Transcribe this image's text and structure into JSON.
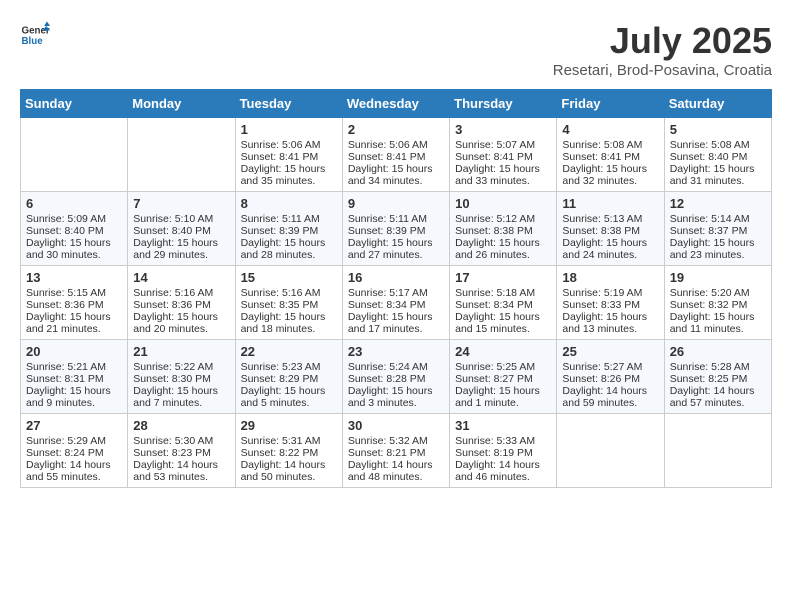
{
  "header": {
    "logo_line1": "General",
    "logo_line2": "Blue",
    "month_year": "July 2025",
    "location": "Resetari, Brod-Posavina, Croatia"
  },
  "weekdays": [
    "Sunday",
    "Monday",
    "Tuesday",
    "Wednesday",
    "Thursday",
    "Friday",
    "Saturday"
  ],
  "weeks": [
    [
      {
        "day": "",
        "sunrise": "",
        "sunset": "",
        "daylight": ""
      },
      {
        "day": "",
        "sunrise": "",
        "sunset": "",
        "daylight": ""
      },
      {
        "day": "1",
        "sunrise": "Sunrise: 5:06 AM",
        "sunset": "Sunset: 8:41 PM",
        "daylight": "Daylight: 15 hours and 35 minutes."
      },
      {
        "day": "2",
        "sunrise": "Sunrise: 5:06 AM",
        "sunset": "Sunset: 8:41 PM",
        "daylight": "Daylight: 15 hours and 34 minutes."
      },
      {
        "day": "3",
        "sunrise": "Sunrise: 5:07 AM",
        "sunset": "Sunset: 8:41 PM",
        "daylight": "Daylight: 15 hours and 33 minutes."
      },
      {
        "day": "4",
        "sunrise": "Sunrise: 5:08 AM",
        "sunset": "Sunset: 8:41 PM",
        "daylight": "Daylight: 15 hours and 32 minutes."
      },
      {
        "day": "5",
        "sunrise": "Sunrise: 5:08 AM",
        "sunset": "Sunset: 8:40 PM",
        "daylight": "Daylight: 15 hours and 31 minutes."
      }
    ],
    [
      {
        "day": "6",
        "sunrise": "Sunrise: 5:09 AM",
        "sunset": "Sunset: 8:40 PM",
        "daylight": "Daylight: 15 hours and 30 minutes."
      },
      {
        "day": "7",
        "sunrise": "Sunrise: 5:10 AM",
        "sunset": "Sunset: 8:40 PM",
        "daylight": "Daylight: 15 hours and 29 minutes."
      },
      {
        "day": "8",
        "sunrise": "Sunrise: 5:11 AM",
        "sunset": "Sunset: 8:39 PM",
        "daylight": "Daylight: 15 hours and 28 minutes."
      },
      {
        "day": "9",
        "sunrise": "Sunrise: 5:11 AM",
        "sunset": "Sunset: 8:39 PM",
        "daylight": "Daylight: 15 hours and 27 minutes."
      },
      {
        "day": "10",
        "sunrise": "Sunrise: 5:12 AM",
        "sunset": "Sunset: 8:38 PM",
        "daylight": "Daylight: 15 hours and 26 minutes."
      },
      {
        "day": "11",
        "sunrise": "Sunrise: 5:13 AM",
        "sunset": "Sunset: 8:38 PM",
        "daylight": "Daylight: 15 hours and 24 minutes."
      },
      {
        "day": "12",
        "sunrise": "Sunrise: 5:14 AM",
        "sunset": "Sunset: 8:37 PM",
        "daylight": "Daylight: 15 hours and 23 minutes."
      }
    ],
    [
      {
        "day": "13",
        "sunrise": "Sunrise: 5:15 AM",
        "sunset": "Sunset: 8:36 PM",
        "daylight": "Daylight: 15 hours and 21 minutes."
      },
      {
        "day": "14",
        "sunrise": "Sunrise: 5:16 AM",
        "sunset": "Sunset: 8:36 PM",
        "daylight": "Daylight: 15 hours and 20 minutes."
      },
      {
        "day": "15",
        "sunrise": "Sunrise: 5:16 AM",
        "sunset": "Sunset: 8:35 PM",
        "daylight": "Daylight: 15 hours and 18 minutes."
      },
      {
        "day": "16",
        "sunrise": "Sunrise: 5:17 AM",
        "sunset": "Sunset: 8:34 PM",
        "daylight": "Daylight: 15 hours and 17 minutes."
      },
      {
        "day": "17",
        "sunrise": "Sunrise: 5:18 AM",
        "sunset": "Sunset: 8:34 PM",
        "daylight": "Daylight: 15 hours and 15 minutes."
      },
      {
        "day": "18",
        "sunrise": "Sunrise: 5:19 AM",
        "sunset": "Sunset: 8:33 PM",
        "daylight": "Daylight: 15 hours and 13 minutes."
      },
      {
        "day": "19",
        "sunrise": "Sunrise: 5:20 AM",
        "sunset": "Sunset: 8:32 PM",
        "daylight": "Daylight: 15 hours and 11 minutes."
      }
    ],
    [
      {
        "day": "20",
        "sunrise": "Sunrise: 5:21 AM",
        "sunset": "Sunset: 8:31 PM",
        "daylight": "Daylight: 15 hours and 9 minutes."
      },
      {
        "day": "21",
        "sunrise": "Sunrise: 5:22 AM",
        "sunset": "Sunset: 8:30 PM",
        "daylight": "Daylight: 15 hours and 7 minutes."
      },
      {
        "day": "22",
        "sunrise": "Sunrise: 5:23 AM",
        "sunset": "Sunset: 8:29 PM",
        "daylight": "Daylight: 15 hours and 5 minutes."
      },
      {
        "day": "23",
        "sunrise": "Sunrise: 5:24 AM",
        "sunset": "Sunset: 8:28 PM",
        "daylight": "Daylight: 15 hours and 3 minutes."
      },
      {
        "day": "24",
        "sunrise": "Sunrise: 5:25 AM",
        "sunset": "Sunset: 8:27 PM",
        "daylight": "Daylight: 15 hours and 1 minute."
      },
      {
        "day": "25",
        "sunrise": "Sunrise: 5:27 AM",
        "sunset": "Sunset: 8:26 PM",
        "daylight": "Daylight: 14 hours and 59 minutes."
      },
      {
        "day": "26",
        "sunrise": "Sunrise: 5:28 AM",
        "sunset": "Sunset: 8:25 PM",
        "daylight": "Daylight: 14 hours and 57 minutes."
      }
    ],
    [
      {
        "day": "27",
        "sunrise": "Sunrise: 5:29 AM",
        "sunset": "Sunset: 8:24 PM",
        "daylight": "Daylight: 14 hours and 55 minutes."
      },
      {
        "day": "28",
        "sunrise": "Sunrise: 5:30 AM",
        "sunset": "Sunset: 8:23 PM",
        "daylight": "Daylight: 14 hours and 53 minutes."
      },
      {
        "day": "29",
        "sunrise": "Sunrise: 5:31 AM",
        "sunset": "Sunset: 8:22 PM",
        "daylight": "Daylight: 14 hours and 50 minutes."
      },
      {
        "day": "30",
        "sunrise": "Sunrise: 5:32 AM",
        "sunset": "Sunset: 8:21 PM",
        "daylight": "Daylight: 14 hours and 48 minutes."
      },
      {
        "day": "31",
        "sunrise": "Sunrise: 5:33 AM",
        "sunset": "Sunset: 8:19 PM",
        "daylight": "Daylight: 14 hours and 46 minutes."
      },
      {
        "day": "",
        "sunrise": "",
        "sunset": "",
        "daylight": ""
      },
      {
        "day": "",
        "sunrise": "",
        "sunset": "",
        "daylight": ""
      }
    ]
  ]
}
